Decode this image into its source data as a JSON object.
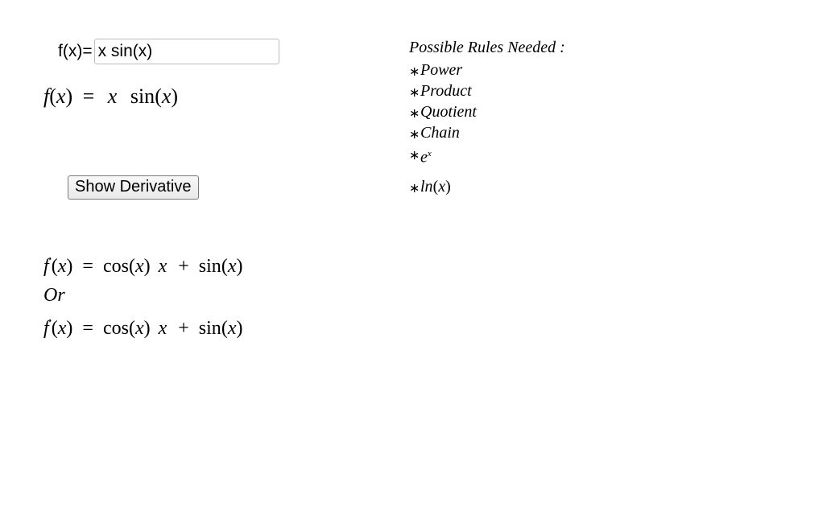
{
  "input": {
    "label": "f(x)=",
    "value": "x sin(x)"
  },
  "function_display": {
    "prefix": "f",
    "arg_open": "(",
    "arg": "x",
    "arg_close": ")",
    "eq": "=",
    "body_x": "x",
    "body_fn": "sin",
    "body_open": "(",
    "body_arg": "x",
    "body_close": ")"
  },
  "button": {
    "label": "Show Derivative"
  },
  "derivative": {
    "line1": {
      "f": "f",
      "prime": "′",
      "open": "(",
      "arg": "x",
      "close": ")",
      "eq": "=",
      "t1_fn": "cos",
      "t1_open": "(",
      "t1_arg": "x",
      "t1_close": ")",
      "t1_x": "x",
      "plus": "+",
      "t2_fn": "sin",
      "t2_open": "(",
      "t2_arg": "x",
      "t2_close": ")"
    },
    "or": "Or",
    "line2": {
      "f": "f",
      "prime": "′",
      "open": "(",
      "arg": "x",
      "close": ")",
      "eq": "=",
      "t1_fn": "cos",
      "t1_open": "(",
      "t1_arg": "x",
      "t1_close": ")",
      "t1_x": "x",
      "plus": "+",
      "t2_fn": "sin",
      "t2_open": "(",
      "t2_arg": "x",
      "t2_close": ")"
    }
  },
  "rules": {
    "title": "Possible Rules Needed :",
    "items": {
      "power": "Power",
      "product": "Product",
      "quotient": "Quotient",
      "chain": "Chain",
      "ex_e": "e",
      "ex_sup": "x",
      "ln": "ln",
      "ln_open": "(",
      "ln_arg": "x",
      "ln_close": ")"
    }
  }
}
